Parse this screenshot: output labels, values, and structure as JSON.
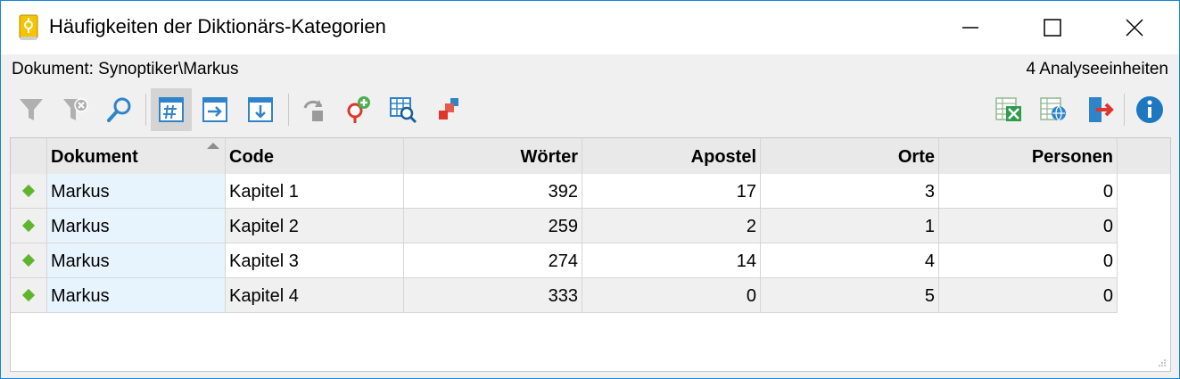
{
  "window": {
    "title": "Häufigkeiten der Diktionärs-Kategorien",
    "accent": "#1883d7"
  },
  "info": {
    "document_label": "Dokument: Synoptiker\\Markus",
    "units_label": "4 Analyseeinheiten"
  },
  "toolbar": {
    "icons": [
      "filter-icon",
      "clear-filter-icon",
      "search-icon",
      "frequency-table-icon",
      "forward-icon",
      "export-down-icon",
      "undo-icon",
      "add-code-icon",
      "table-search-icon",
      "heatmap-icon",
      "excel-export-icon",
      "web-export-icon",
      "exit-icon",
      "info-icon"
    ]
  },
  "table": {
    "columns": [
      "Dokument",
      "Code",
      "Wörter",
      "Apostel",
      "Orte",
      "Personen"
    ],
    "sorted_column": "Dokument",
    "rows": [
      {
        "dokument": "Markus",
        "code": "Kapitel 1",
        "woerter": "392",
        "apostel": "17",
        "orte": "3",
        "personen": "0"
      },
      {
        "dokument": "Markus",
        "code": "Kapitel 2",
        "woerter": "259",
        "apostel": "2",
        "orte": "1",
        "personen": "0"
      },
      {
        "dokument": "Markus",
        "code": "Kapitel 3",
        "woerter": "274",
        "apostel": "14",
        "orte": "4",
        "personen": "0"
      },
      {
        "dokument": "Markus",
        "code": "Kapitel 4",
        "woerter": "333",
        "apostel": "0",
        "orte": "5",
        "personen": "0"
      }
    ]
  }
}
